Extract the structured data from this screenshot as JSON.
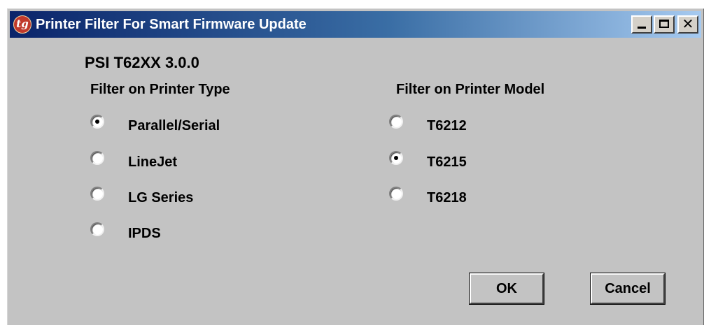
{
  "window": {
    "title": "Printer Filter For Smart Firmware Update",
    "app_icon_text": "tg",
    "minimize_symbol": "",
    "maximize_symbol": "",
    "close_symbol": "✕"
  },
  "app_title": "PSI T62XX 3.0.0",
  "printer_type": {
    "label": "Filter on Printer Type",
    "options": [
      {
        "label": "Parallel/Serial",
        "checked": true
      },
      {
        "label": "LineJet",
        "checked": false
      },
      {
        "label": "LG Series",
        "checked": false
      },
      {
        "label": "IPDS",
        "checked": false
      }
    ]
  },
  "printer_model": {
    "label": "Filter on Printer Model",
    "options": [
      {
        "label": "T6212",
        "checked": false
      },
      {
        "label": "T6215",
        "checked": true
      },
      {
        "label": "T6218",
        "checked": false
      }
    ]
  },
  "buttons": {
    "ok": "OK",
    "cancel": "Cancel"
  },
  "colors": {
    "title_gradient_start": "#0a246a",
    "title_gradient_end": "#a6caf0",
    "window_background": "#c3c3c3",
    "app_icon": "#c0392b"
  },
  "icons": {
    "app": "tg-logo-icon",
    "minimize": "minimize-icon",
    "maximize": "maximize-icon",
    "close": "close-icon"
  }
}
